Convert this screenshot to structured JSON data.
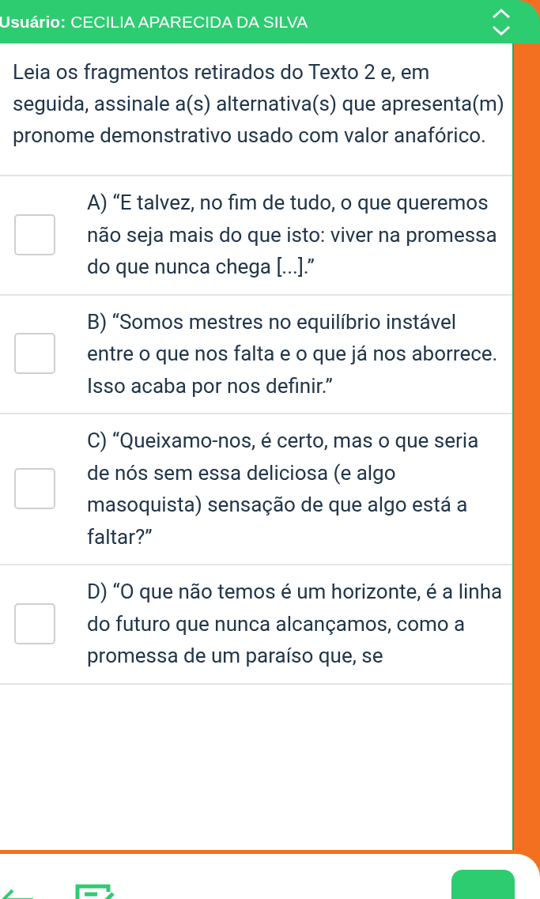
{
  "header": {
    "label": "Usuário:",
    "user": "CECILIA APARECIDA DA SILVA"
  },
  "question": "Leia os fragmentos retirados do Texto 2 e, em seguida, assinale a(s) alternativa(s) que apresenta(m) pronome demonstrativo usado com valor anafórico.",
  "options": [
    {
      "text": "A) “E talvez, no fim de tudo, o que queremos não seja mais do que isto: viver na promessa do que nunca chega [...].”",
      "checked": false
    },
    {
      "text": "B) “Somos mestres no equilíbrio instável entre o que nos falta e o que já nos aborrece. Isso acaba por nos definir.”",
      "checked": false
    },
    {
      "text": "C) “Queixamo-nos, é certo, mas o que seria de nós sem essa deliciosa (e algo masoquista) sensação de que algo está a faltar?”",
      "checked": false
    },
    {
      "text": "D) “O que não temos é um horizonte, é a linha do futuro que nunca alcançamos, como a promessa de um paraíso que, se",
      "checked": false
    }
  ]
}
